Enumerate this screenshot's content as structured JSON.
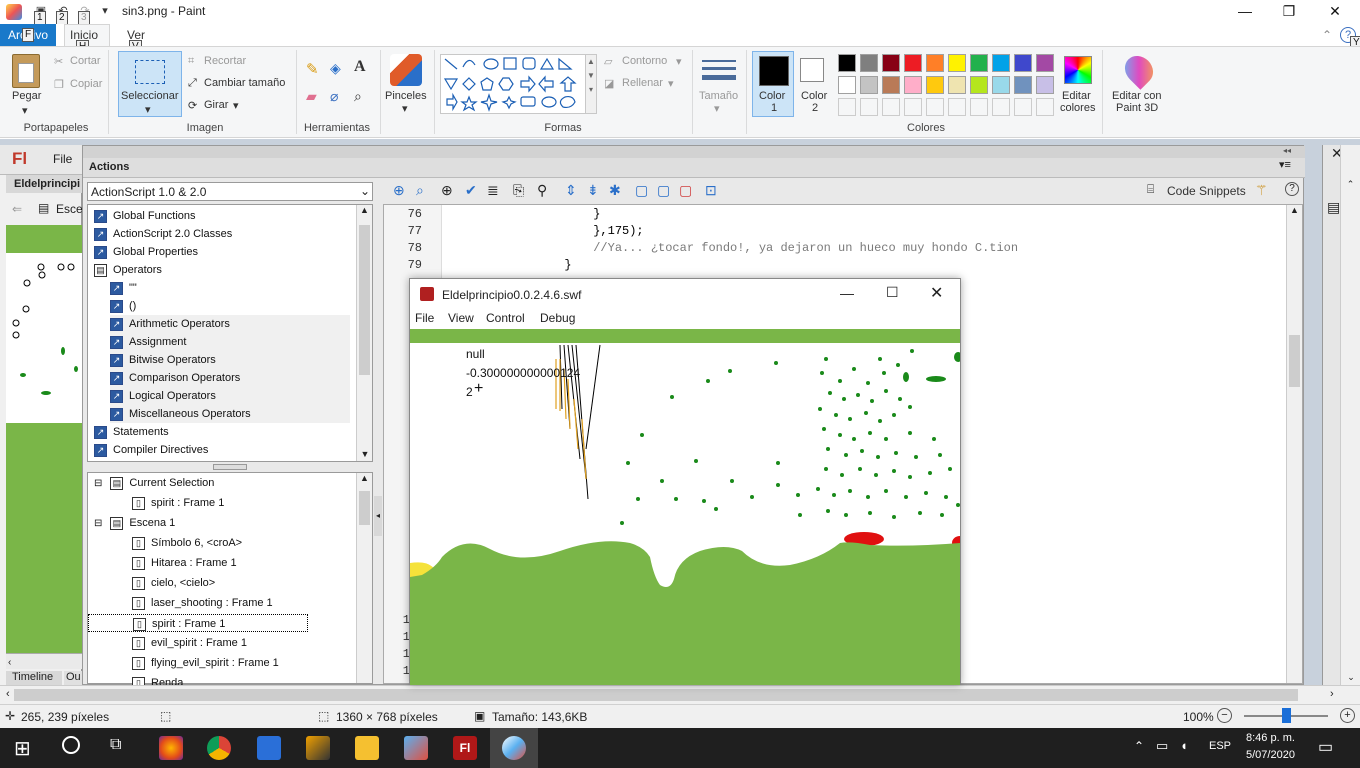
{
  "window": {
    "title": "sin3.png - Paint"
  },
  "quick_access": {
    "keytip_1": "1",
    "keytip_2": "2",
    "keytip_3": "3",
    "keytip_h": "H",
    "keytip_v": "V",
    "keytip_y": "Y",
    "file_keytip": "F"
  },
  "tabs": {
    "file": "Archivo",
    "inicio": "Inicio",
    "ver": "Ver"
  },
  "ribbon": {
    "clipboard": {
      "paste": "Pegar",
      "cut": "Cortar",
      "copy": "Copiar",
      "group": "Portapapeles"
    },
    "image": {
      "select": "Seleccionar",
      "crop": "Recortar",
      "resize": "Cambiar tamaño",
      "rotate": "Girar",
      "group": "Imagen"
    },
    "tools": {
      "group": "Herramientas"
    },
    "brushes": {
      "label": "Pinceles"
    },
    "shapes": {
      "outline": "Contorno",
      "fill": "Rellenar",
      "group": "Formas"
    },
    "size": {
      "label": "Tamaño"
    },
    "colors": {
      "color1": "Color",
      "color1_num": "1",
      "color2": "Color",
      "color2_num": "2",
      "edit": "Editar",
      "edit2": "colores",
      "group": "Colores",
      "paint3d": "Editar con",
      "paint3d_2": "Paint 3D"
    },
    "palette_row1": [
      "#000000",
      "#7f7f7f",
      "#880015",
      "#ed1c24",
      "#ff7f27",
      "#fff200",
      "#22b14c",
      "#00a2e8",
      "#3f48cc",
      "#a349a4"
    ],
    "palette_row2": [
      "#ffffff",
      "#c3c3c3",
      "#b97a57",
      "#ffaec9",
      "#ffc90e",
      "#efe4b0",
      "#b5e61d",
      "#99d9ea",
      "#7092be",
      "#c8bfe7"
    ]
  },
  "flash": {
    "logo": "Fl",
    "file_menu": "File",
    "doc_tab": "Eldelprincipi",
    "scene_label": "Esce",
    "timeline_tab": "Timeline",
    "output_tab": "Ou"
  },
  "actions": {
    "panel_title": "Actions",
    "language": "ActionScript 1.0 & 2.0",
    "code_snippets": "Code Snippets",
    "toolbox": [
      {
        "label": "Global Functions",
        "indent": 0
      },
      {
        "label": "ActionScript 2.0 Classes",
        "indent": 0
      },
      {
        "label": "Global Properties",
        "indent": 0
      },
      {
        "label": "Operators",
        "indent": 0
      },
      {
        "label": "\"\"",
        "indent": 1
      },
      {
        "label": "()",
        "indent": 1
      },
      {
        "label": "Arithmetic Operators",
        "indent": 1
      },
      {
        "label": "Assignment",
        "indent": 1
      },
      {
        "label": "Bitwise Operators",
        "indent": 1
      },
      {
        "label": "Comparison Operators",
        "indent": 1
      },
      {
        "label": "Logical Operators",
        "indent": 1
      },
      {
        "label": "Miscellaneous Operators",
        "indent": 1
      },
      {
        "label": "Statements",
        "indent": 0
      },
      {
        "label": "Compiler Directives",
        "indent": 0
      }
    ],
    "script_nav": [
      {
        "label": "Current Selection",
        "indent": 0
      },
      {
        "label": "spirit : Frame 1",
        "indent": 1
      },
      {
        "label": "Escena 1",
        "indent": 0
      },
      {
        "label": "Símbolo 6, <croA>",
        "indent": 1
      },
      {
        "label": "Hitarea : Frame 1",
        "indent": 1
      },
      {
        "label": "cielo, <cielo>",
        "indent": 1
      },
      {
        "label": "laser_shooting : Frame 1",
        "indent": 1
      },
      {
        "label": "spirit : Frame 1",
        "indent": 1
      },
      {
        "label": "evil_spirit : Frame 1",
        "indent": 1
      },
      {
        "label": "flying_evil_spirit : Frame 1",
        "indent": 1
      },
      {
        "label": "Renda",
        "indent": 1
      }
    ],
    "code": [
      {
        "num": "76",
        "text": "                }"
      },
      {
        "num": "77",
        "text": "                },175);"
      },
      {
        "num": "78",
        "text": "                //Ya... ¿tocar fondo!, ya dejaron un hueco muy hondo C.tion"
      },
      {
        "num": "79",
        "text": "            }"
      }
    ],
    "lower_line_nums": [
      "1",
      "1",
      "1",
      "1"
    ]
  },
  "swf": {
    "title": "Eldelprincipio0.0.2.4.6.swf",
    "menu": [
      "File",
      "View",
      "Control",
      "Debug"
    ],
    "trace": [
      "null",
      "-0.300000000000124",
      "2"
    ]
  },
  "status": {
    "cursor": "265, 239 píxeles",
    "dimensions": "1360 × 768 píxeles",
    "size": "Tamaño: 143,6KB",
    "zoom": "100%"
  },
  "taskbar": {
    "lang": "ESP",
    "time": "8:46 p. m.",
    "date": "5/07/2020"
  }
}
